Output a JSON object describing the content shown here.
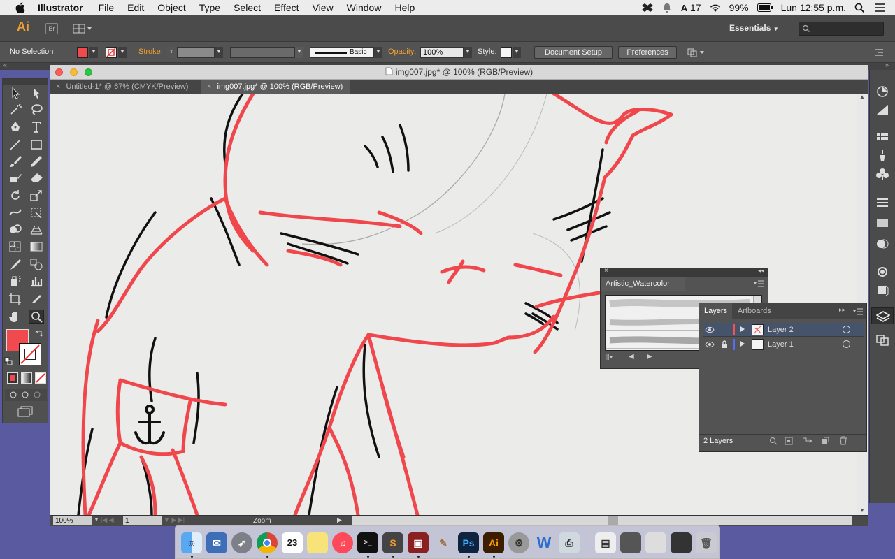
{
  "menubar": {
    "app_name": "Illustrator",
    "items": [
      "File",
      "Edit",
      "Object",
      "Type",
      "Select",
      "Effect",
      "View",
      "Window",
      "Help"
    ],
    "status": {
      "notif_count": "17",
      "battery": "99%",
      "clock": "Lun 12:55 p.m."
    }
  },
  "appbar": {
    "logo": "Ai",
    "bridge": "Br",
    "workspace": "Essentials"
  },
  "control": {
    "selection": "No Selection",
    "stroke_label": "Stroke:",
    "brush_style": "Basic",
    "opacity_label": "Opacity:",
    "opacity_value": "100%",
    "style_label": "Style:",
    "doc_setup": "Document Setup",
    "preferences": "Preferences"
  },
  "document": {
    "window_title": "img007.jpg* @ 100% (RGB/Preview)",
    "tabs": [
      {
        "label": "Untitled-1* @ 67% (CMYK/Preview)"
      },
      {
        "label": "img007.jpg* @ 100% (RGB/Preview)"
      }
    ],
    "zoom": "100%",
    "page": "1",
    "status_label": "Zoom"
  },
  "brush_panel": {
    "title": "Artistic_Watercolor"
  },
  "layers_panel": {
    "tabs": [
      "Layers",
      "Artboards"
    ],
    "layers": [
      {
        "name": "Layer 2",
        "color": "#ff4f4f",
        "locked": false
      },
      {
        "name": "Layer 1",
        "color": "#4f6fff",
        "locked": true
      }
    ],
    "count": "2 Layers"
  },
  "colors": {
    "fill": "#f04a4f",
    "accent": "#f0a030",
    "stroke_art": "#f0474c"
  }
}
